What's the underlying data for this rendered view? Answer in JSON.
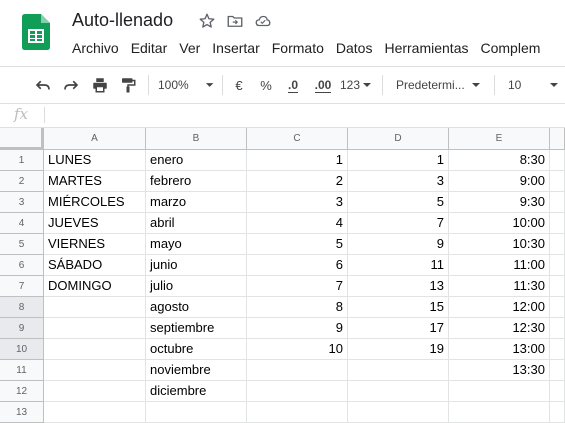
{
  "header": {
    "title": "Auto-llenado",
    "menu": [
      "Archivo",
      "Editar",
      "Ver",
      "Insertar",
      "Formato",
      "Datos",
      "Herramientas",
      "Complem"
    ]
  },
  "toolbar": {
    "zoom": "100%",
    "currency": "€",
    "percent": "%",
    "dec_less": ".0",
    "dec_more": ".00",
    "format_more": "123",
    "font": "Predetermi...",
    "font_size": "10"
  },
  "formula_bar": {
    "fx_label": "fx",
    "value": ""
  },
  "sheet": {
    "columns": [
      "A",
      "B",
      "C",
      "D",
      "E"
    ],
    "rows": [
      {
        "num": "1",
        "a": "LUNES",
        "b": "enero",
        "c": "1",
        "d": "1",
        "e": "8:30"
      },
      {
        "num": "2",
        "a": "MARTES",
        "b": "febrero",
        "c": "2",
        "d": "3",
        "e": "9:00"
      },
      {
        "num": "3",
        "a": "MIÉRCOLES",
        "b": "marzo",
        "c": "3",
        "d": "5",
        "e": "9:30"
      },
      {
        "num": "4",
        "a": "JUEVES",
        "b": "abril",
        "c": "4",
        "d": "7",
        "e": "10:00"
      },
      {
        "num": "5",
        "a": "VIERNES",
        "b": "mayo",
        "c": "5",
        "d": "9",
        "e": "10:30"
      },
      {
        "num": "6",
        "a": "SÁBADO",
        "b": "junio",
        "c": "6",
        "d": "11",
        "e": "11:00"
      },
      {
        "num": "7",
        "a": "DOMINGO",
        "b": "julio",
        "c": "7",
        "d": "13",
        "e": "11:30"
      },
      {
        "num": "8",
        "a": "",
        "b": "agosto",
        "c": "8",
        "d": "15",
        "e": "12:00"
      },
      {
        "num": "9",
        "a": "",
        "b": "septiembre",
        "c": "9",
        "d": "17",
        "e": "12:30"
      },
      {
        "num": "10",
        "a": "",
        "b": "octubre",
        "c": "10",
        "d": "19",
        "e": "13:00"
      },
      {
        "num": "11",
        "a": "",
        "b": "noviembre",
        "c": "",
        "d": "",
        "e": "13:30"
      },
      {
        "num": "12",
        "a": "",
        "b": "diciembre",
        "c": "",
        "d": "",
        "e": ""
      },
      {
        "num": "13",
        "a": "",
        "b": "",
        "c": "",
        "d": "",
        "e": ""
      }
    ]
  },
  "colors": {
    "sheets_green": "#0F9D58",
    "header_bg": "#f8f9fa",
    "grid": "#e2e3e3"
  }
}
